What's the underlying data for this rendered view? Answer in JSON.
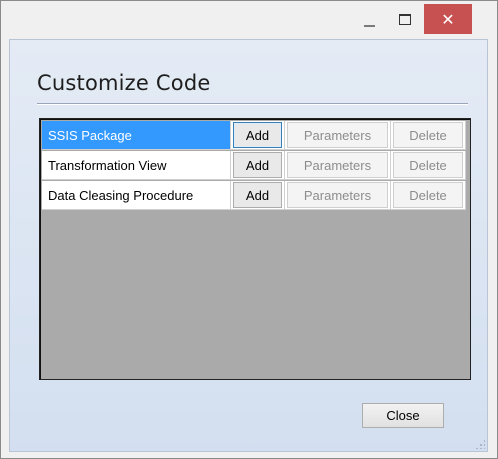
{
  "window": {
    "minimize_icon": "minimize-icon",
    "maximize_icon": "maximize-icon",
    "close_glyph": "✕",
    "close_color": "#c75050"
  },
  "page": {
    "title": "Customize Code"
  },
  "grid": {
    "selection_color": "#3399ff",
    "empty_area_color": "#aaaaaa",
    "rows": [
      {
        "name": "SSIS Package",
        "selected": true,
        "add_label": "Add",
        "parameters_label": "Parameters",
        "delete_label": "Delete",
        "parameters_enabled": false,
        "delete_enabled": false
      },
      {
        "name": "Transformation View",
        "selected": false,
        "add_label": "Add",
        "parameters_label": "Parameters",
        "delete_label": "Delete",
        "parameters_enabled": false,
        "delete_enabled": false
      },
      {
        "name": "Data Cleasing Procedure",
        "selected": false,
        "add_label": "Add",
        "parameters_label": "Parameters",
        "delete_label": "Delete",
        "parameters_enabled": false,
        "delete_enabled": false
      }
    ]
  },
  "footer": {
    "close_label": "Close"
  }
}
